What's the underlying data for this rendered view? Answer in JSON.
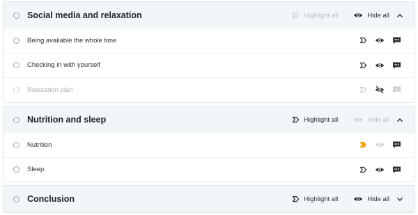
{
  "sections": [
    {
      "title": "Social media and relaxation",
      "highlight_all": "Highlight all",
      "hide_all": "Hide all",
      "highlight_disabled": true,
      "hide_disabled": false,
      "expanded": true,
      "items": [
        {
          "label": "Being available the whole time",
          "highlighted": false,
          "hidden": false,
          "disabled": false
        },
        {
          "label": "Checking in with yourself",
          "highlighted": false,
          "hidden": false,
          "disabled": false
        },
        {
          "label": "Relaxation plan",
          "highlighted": false,
          "hidden": true,
          "disabled": true
        }
      ]
    },
    {
      "title": "Nutrition and sleep",
      "highlight_all": "Highlight all",
      "hide_all": "Hide all",
      "highlight_disabled": false,
      "hide_disabled": true,
      "expanded": true,
      "items": [
        {
          "label": "Nutrition",
          "highlighted": true,
          "hidden": false,
          "disabled": false
        },
        {
          "label": "Sleep",
          "highlighted": false,
          "hidden": false,
          "disabled": false
        }
      ]
    },
    {
      "title": "Conclusion",
      "highlight_all": "Highlight all",
      "hide_all": "Hide all",
      "highlight_disabled": false,
      "hide_disabled": false,
      "expanded": false,
      "items": []
    }
  ],
  "colors": {
    "highlight_active": "#f0a30a",
    "icon_dark": "#2b2f33",
    "icon_disabled": "#c8ced2",
    "header_bg": "#f1f6f9"
  },
  "icons": {
    "highlight": "highlight-tag-icon",
    "eye": "eye-icon",
    "eye_off": "eye-off-icon",
    "comment": "comment-icon",
    "chevron_up": "chevron-up-icon",
    "chevron_down": "chevron-down-icon"
  }
}
